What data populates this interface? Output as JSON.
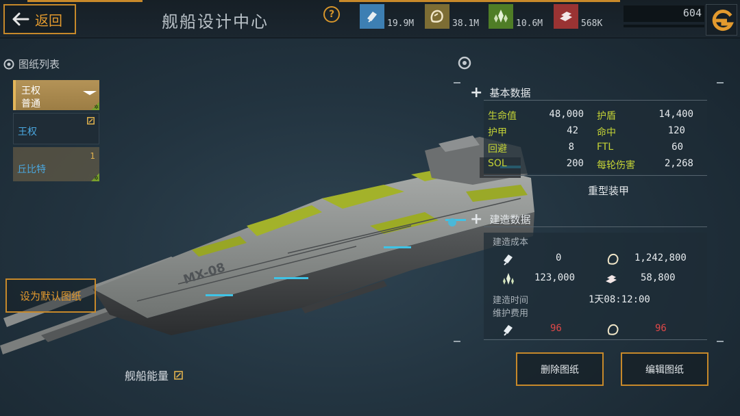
{
  "header": {
    "back_label": "返回",
    "title": "舰船设计中心",
    "help_icon": "help-circle-icon",
    "credits": "604"
  },
  "resources": [
    {
      "name": "metal",
      "icon": "metal-ingot-icon",
      "value": "19.9M",
      "color": "#3d7fb3"
    },
    {
      "name": "crystal",
      "icon": "crystal-ore-icon",
      "value": "38.1M",
      "color": "#8a7a3a"
    },
    {
      "name": "deuterium",
      "icon": "crystal-cluster-icon",
      "value": "10.6M",
      "color": "#5a8a2a"
    },
    {
      "name": "alloy",
      "icon": "alloy-stack-icon",
      "value": "568K",
      "color": "#a33838"
    }
  ],
  "blueprints": {
    "heading": "图纸列表",
    "items": [
      {
        "name": "王权",
        "grade": "普通",
        "selected": true
      },
      {
        "name": "王权",
        "selected": false
      },
      {
        "name": "丘比特",
        "count": "1",
        "selected": false
      }
    ],
    "set_default_label": "设为默认图纸"
  },
  "ship": {
    "hull_code": "MX-08",
    "energy_label": "舰船能量"
  },
  "basic_stats": {
    "title": "基本数据",
    "rows": [
      {
        "l1": "生命值",
        "v1": "48,000",
        "l2": "护盾",
        "v2": "14,400"
      },
      {
        "l1": "护甲",
        "v1": "42",
        "l2": "命中",
        "v2": "120"
      },
      {
        "l1": "回避",
        "v1": "8",
        "l2": "FTL",
        "v2": "60"
      },
      {
        "l1": "SOL",
        "v1": "200",
        "l2": "每轮伤害",
        "v2": "2,268"
      }
    ],
    "armor_type": "重型装甲"
  },
  "build_stats": {
    "title": "建造数据",
    "cost_label": "建造成本",
    "costs": {
      "metal": "0",
      "crystal": "1,242,800",
      "deuterium": "123,000",
      "alloy": "58,800"
    },
    "time_label": "建造时间",
    "time_value": "1天08:12:00",
    "upkeep_label": "维护费用",
    "upkeep_metal": "96",
    "upkeep_crystal": "96"
  },
  "actions": {
    "delete_label": "删除图纸",
    "edit_label": "编辑图纸"
  }
}
